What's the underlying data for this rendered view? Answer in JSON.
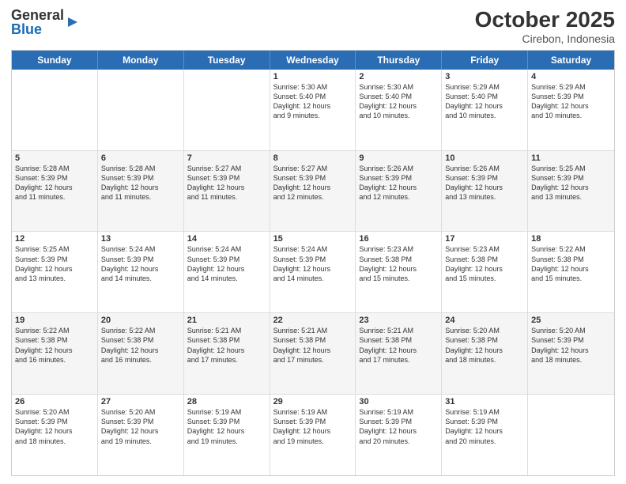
{
  "logo": {
    "general": "General",
    "blue": "Blue"
  },
  "title": "October 2025",
  "subtitle": "Cirebon, Indonesia",
  "days": [
    "Sunday",
    "Monday",
    "Tuesday",
    "Wednesday",
    "Thursday",
    "Friday",
    "Saturday"
  ],
  "rows": [
    [
      {
        "day": "",
        "info": ""
      },
      {
        "day": "",
        "info": ""
      },
      {
        "day": "",
        "info": ""
      },
      {
        "day": "1",
        "info": "Sunrise: 5:30 AM\nSunset: 5:40 PM\nDaylight: 12 hours\nand 9 minutes."
      },
      {
        "day": "2",
        "info": "Sunrise: 5:30 AM\nSunset: 5:40 PM\nDaylight: 12 hours\nand 10 minutes."
      },
      {
        "day": "3",
        "info": "Sunrise: 5:29 AM\nSunset: 5:40 PM\nDaylight: 12 hours\nand 10 minutes."
      },
      {
        "day": "4",
        "info": "Sunrise: 5:29 AM\nSunset: 5:39 PM\nDaylight: 12 hours\nand 10 minutes."
      }
    ],
    [
      {
        "day": "5",
        "info": "Sunrise: 5:28 AM\nSunset: 5:39 PM\nDaylight: 12 hours\nand 11 minutes."
      },
      {
        "day": "6",
        "info": "Sunrise: 5:28 AM\nSunset: 5:39 PM\nDaylight: 12 hours\nand 11 minutes."
      },
      {
        "day": "7",
        "info": "Sunrise: 5:27 AM\nSunset: 5:39 PM\nDaylight: 12 hours\nand 11 minutes."
      },
      {
        "day": "8",
        "info": "Sunrise: 5:27 AM\nSunset: 5:39 PM\nDaylight: 12 hours\nand 12 minutes."
      },
      {
        "day": "9",
        "info": "Sunrise: 5:26 AM\nSunset: 5:39 PM\nDaylight: 12 hours\nand 12 minutes."
      },
      {
        "day": "10",
        "info": "Sunrise: 5:26 AM\nSunset: 5:39 PM\nDaylight: 12 hours\nand 13 minutes."
      },
      {
        "day": "11",
        "info": "Sunrise: 5:25 AM\nSunset: 5:39 PM\nDaylight: 12 hours\nand 13 minutes."
      }
    ],
    [
      {
        "day": "12",
        "info": "Sunrise: 5:25 AM\nSunset: 5:39 PM\nDaylight: 12 hours\nand 13 minutes."
      },
      {
        "day": "13",
        "info": "Sunrise: 5:24 AM\nSunset: 5:39 PM\nDaylight: 12 hours\nand 14 minutes."
      },
      {
        "day": "14",
        "info": "Sunrise: 5:24 AM\nSunset: 5:39 PM\nDaylight: 12 hours\nand 14 minutes."
      },
      {
        "day": "15",
        "info": "Sunrise: 5:24 AM\nSunset: 5:39 PM\nDaylight: 12 hours\nand 14 minutes."
      },
      {
        "day": "16",
        "info": "Sunrise: 5:23 AM\nSunset: 5:38 PM\nDaylight: 12 hours\nand 15 minutes."
      },
      {
        "day": "17",
        "info": "Sunrise: 5:23 AM\nSunset: 5:38 PM\nDaylight: 12 hours\nand 15 minutes."
      },
      {
        "day": "18",
        "info": "Sunrise: 5:22 AM\nSunset: 5:38 PM\nDaylight: 12 hours\nand 15 minutes."
      }
    ],
    [
      {
        "day": "19",
        "info": "Sunrise: 5:22 AM\nSunset: 5:38 PM\nDaylight: 12 hours\nand 16 minutes."
      },
      {
        "day": "20",
        "info": "Sunrise: 5:22 AM\nSunset: 5:38 PM\nDaylight: 12 hours\nand 16 minutes."
      },
      {
        "day": "21",
        "info": "Sunrise: 5:21 AM\nSunset: 5:38 PM\nDaylight: 12 hours\nand 17 minutes."
      },
      {
        "day": "22",
        "info": "Sunrise: 5:21 AM\nSunset: 5:38 PM\nDaylight: 12 hours\nand 17 minutes."
      },
      {
        "day": "23",
        "info": "Sunrise: 5:21 AM\nSunset: 5:38 PM\nDaylight: 12 hours\nand 17 minutes."
      },
      {
        "day": "24",
        "info": "Sunrise: 5:20 AM\nSunset: 5:38 PM\nDaylight: 12 hours\nand 18 minutes."
      },
      {
        "day": "25",
        "info": "Sunrise: 5:20 AM\nSunset: 5:39 PM\nDaylight: 12 hours\nand 18 minutes."
      }
    ],
    [
      {
        "day": "26",
        "info": "Sunrise: 5:20 AM\nSunset: 5:39 PM\nDaylight: 12 hours\nand 18 minutes."
      },
      {
        "day": "27",
        "info": "Sunrise: 5:20 AM\nSunset: 5:39 PM\nDaylight: 12 hours\nand 19 minutes."
      },
      {
        "day": "28",
        "info": "Sunrise: 5:19 AM\nSunset: 5:39 PM\nDaylight: 12 hours\nand 19 minutes."
      },
      {
        "day": "29",
        "info": "Sunrise: 5:19 AM\nSunset: 5:39 PM\nDaylight: 12 hours\nand 19 minutes."
      },
      {
        "day": "30",
        "info": "Sunrise: 5:19 AM\nSunset: 5:39 PM\nDaylight: 12 hours\nand 20 minutes."
      },
      {
        "day": "31",
        "info": "Sunrise: 5:19 AM\nSunset: 5:39 PM\nDaylight: 12 hours\nand 20 minutes."
      },
      {
        "day": "",
        "info": ""
      }
    ]
  ]
}
